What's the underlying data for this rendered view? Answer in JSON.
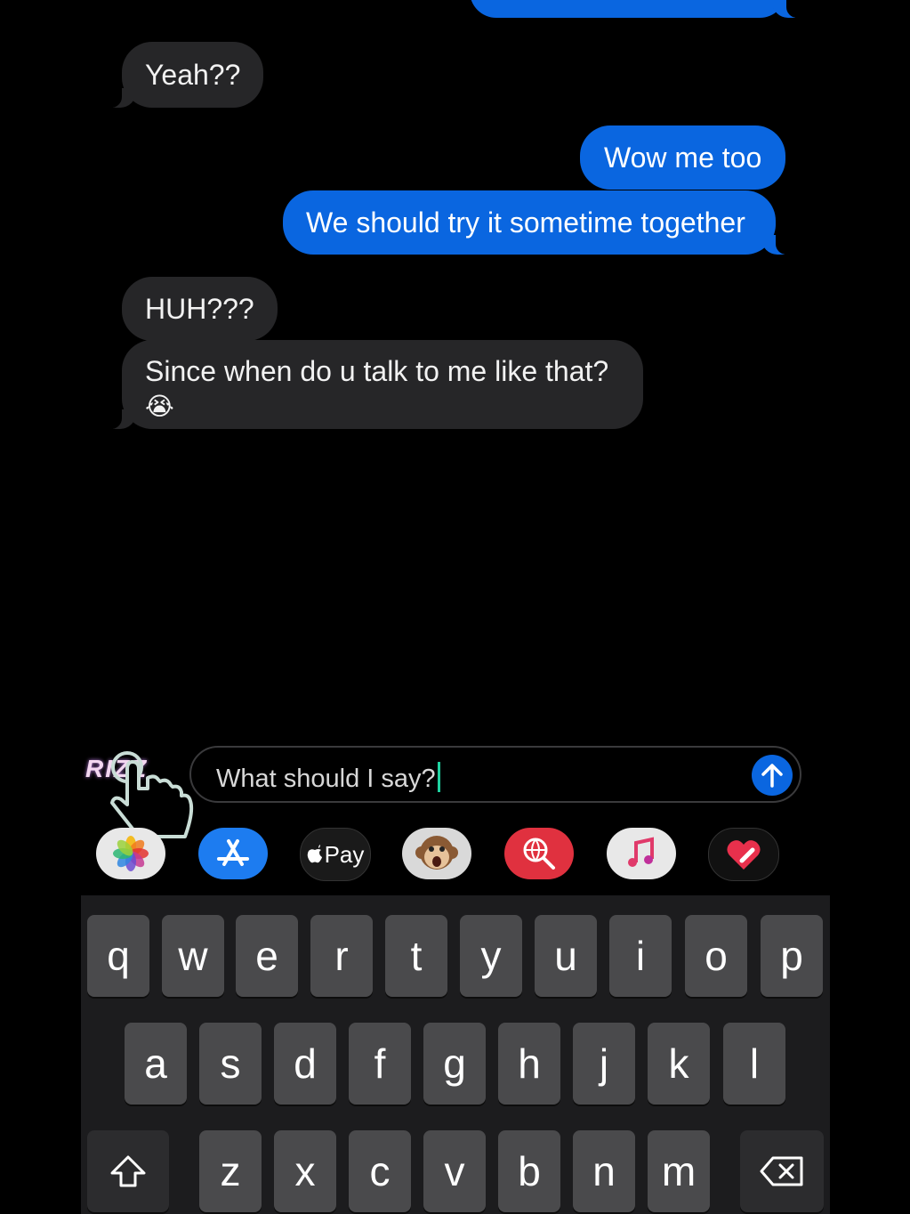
{
  "messages": [
    {
      "side": "out",
      "text": "",
      "partial": true
    },
    {
      "side": "in",
      "text": "Yeah??"
    },
    {
      "side": "out",
      "text": "Wow me too"
    },
    {
      "side": "out",
      "text": "We should try it sometime together"
    },
    {
      "side": "in",
      "text": "HUH???"
    },
    {
      "side": "in",
      "text": "Since when do u talk to me like that?",
      "emoji": "😭"
    }
  ],
  "overlay": {
    "rizz_label": "RIZZ"
  },
  "compose": {
    "text": "What should I say?"
  },
  "apps": [
    "photos-icon",
    "app-store-icon",
    "apple-pay",
    "animoji-icon",
    "web-search-icon",
    "music-icon",
    "digital-touch-icon"
  ],
  "apple_pay_label": "Pay",
  "keyboard": {
    "row1": [
      "q",
      "w",
      "e",
      "r",
      "t",
      "y",
      "u",
      "i",
      "o",
      "p"
    ],
    "row2": [
      "a",
      "s",
      "d",
      "f",
      "g",
      "h",
      "j",
      "k",
      "l"
    ],
    "row3": [
      "z",
      "x",
      "c",
      "v",
      "b",
      "n",
      "m"
    ]
  },
  "colors": {
    "outgoing": "#0a66e0",
    "incoming": "#262628",
    "background": "#000000"
  }
}
